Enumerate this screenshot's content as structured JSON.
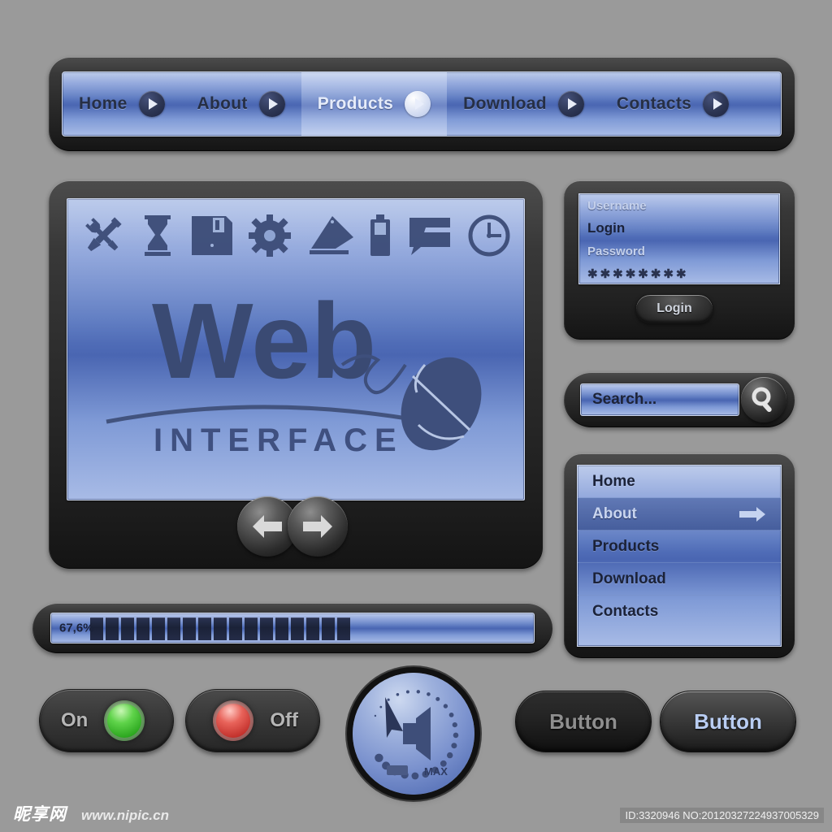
{
  "meta": {
    "background_color": "#9a9a9a",
    "accent_blue": "#5a78c0",
    "bezel_dark": "#262626"
  },
  "navbar": {
    "items": [
      {
        "label": "Home",
        "icon": "play-circle-icon",
        "active": false
      },
      {
        "label": "About",
        "icon": "play-circle-icon",
        "active": false
      },
      {
        "label": "Products",
        "icon": "play-circle-icon",
        "active": true
      },
      {
        "label": "Download",
        "icon": "play-circle-icon",
        "active": false
      },
      {
        "label": "Contacts",
        "icon": "play-circle-icon",
        "active": false
      }
    ]
  },
  "screen": {
    "toolbar_icons": [
      "tools-icon",
      "hourglass-icon",
      "floppy-disk-icon",
      "gear-icon",
      "eraser-icon",
      "battery-icon",
      "speech-bubble-icon",
      "clock-icon"
    ],
    "logo_primary": "Web",
    "logo_secondary": "INTERFACE",
    "decoration_icon": "computer-mouse-icon",
    "prev_label": "Previous",
    "next_label": "Next"
  },
  "login": {
    "username_label": "Username",
    "username_value": "Login",
    "password_label": "Password",
    "password_value": "✱✱✱✱✱✱✱✱",
    "button_label": "Login"
  },
  "search": {
    "placeholder": "Search...",
    "value": "Search...",
    "button_icon": "magnifier-icon"
  },
  "sidemenu": {
    "items": [
      {
        "label": "Home",
        "selected": false
      },
      {
        "label": "About",
        "selected": true
      },
      {
        "label": "Products",
        "selected": false
      },
      {
        "label": "Download",
        "selected": false
      },
      {
        "label": "Contacts",
        "selected": false
      }
    ],
    "selected_arrow_icon": "arrow-right-icon"
  },
  "progress": {
    "percent_label": "67,6%",
    "percent_value": 67.6,
    "block_count": 17
  },
  "toggles": {
    "on_label": "On",
    "off_label": "Off",
    "on_led_color": "#3ec72c",
    "off_led_color": "#d8453c"
  },
  "volume_knob": {
    "icon": "speaker-icon",
    "min_label": "",
    "max_label": "MAX",
    "pointer_icon": "knob-pointer-icon"
  },
  "buttons": {
    "primary_label": "Button",
    "secondary_label": "Button"
  },
  "footer": {
    "watermark_logo": "昵享网",
    "watermark_url": "www.nipic.cn",
    "watermark_id": "ID:3320946 NO:20120327224937005329"
  }
}
